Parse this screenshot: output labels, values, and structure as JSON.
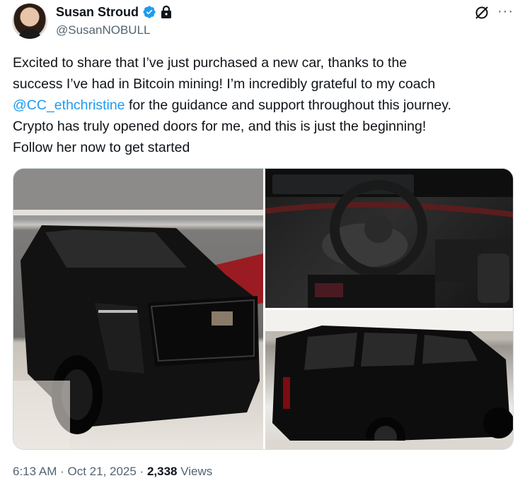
{
  "author": {
    "display_name": "Susan Stroud",
    "handle": "@SusanNOBULL",
    "verified_icon": "verified-badge-icon",
    "protected_icon": "lock-icon"
  },
  "actions": {
    "grok_icon": "grok-icon",
    "more_icon": "more-icon",
    "more_label": "···"
  },
  "tweet": {
    "line1": "Excited to share that I’ve just purchased a new car, thanks to the",
    "line2": "success I’ve had in Bitcoin mining! I’m incredibly grateful to my coach",
    "mention": "@CC_ethchristine",
    "line3_rest": " for the guidance and support throughout this journey.",
    "line4": "Crypto has truly opened doors for me, and this is just the beginning!",
    "line5": "Follow her now to get started"
  },
  "meta": {
    "time": "6:13 AM",
    "sep1": " · ",
    "date": "Oct 21, 2025",
    "sep2": " · ",
    "views_count": "2,338",
    "views_label": " Views"
  },
  "colors": {
    "link": "#1d9bf0",
    "verified": "#1d9bf0",
    "secondary_text": "#536471",
    "primary_text": "#0f1419"
  }
}
